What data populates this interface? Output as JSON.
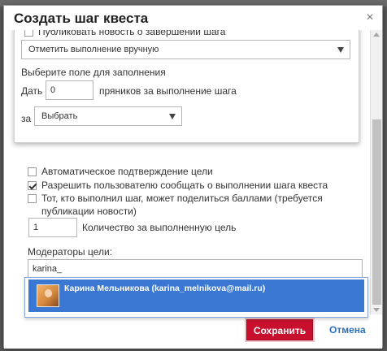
{
  "dialog": {
    "title": "Создать шаг квеста",
    "close_glyph": "×"
  },
  "panel": {
    "publish_news_label": "Публиковать новость о завершении шага",
    "completion_select": "Отметить выполнение вручную",
    "choose_field_label": "Выберите поле для заполнения",
    "give_label": "Дать",
    "gingerbread_value": "0",
    "gingerbread_suffix": "пряников за выполнение шага",
    "for_label": "за",
    "for_select": "Выбрать"
  },
  "options": {
    "auto_confirm_label": "Автоматическое подтверждение цели",
    "allow_report_label": "Разрешить пользователю сообщать о выполнении шага квеста",
    "share_points_label_line1": "Тот, кто выполнил шаг, может поделиться баллами (требуется",
    "share_points_label_line2": "публикации новости)",
    "quantity_value": "1",
    "quantity_label": "Количество за выполненную цель",
    "moderators_label": "Модераторы цели:",
    "moderator_search_value": "karina_"
  },
  "autocomplete": {
    "items": [
      {
        "label": "Карина Мельникова (karina_melnikova@mail.ru)"
      }
    ]
  },
  "footer": {
    "save_label": "Сохранить",
    "cancel_label": "Отмена"
  },
  "state": {
    "publish_news_checked": false,
    "auto_confirm_checked": false,
    "allow_report_checked": true,
    "share_points_checked": false
  },
  "colors": {
    "accent_save": "#c8102e",
    "link": "#2a6ebb",
    "highlight": "#3a78d4"
  }
}
